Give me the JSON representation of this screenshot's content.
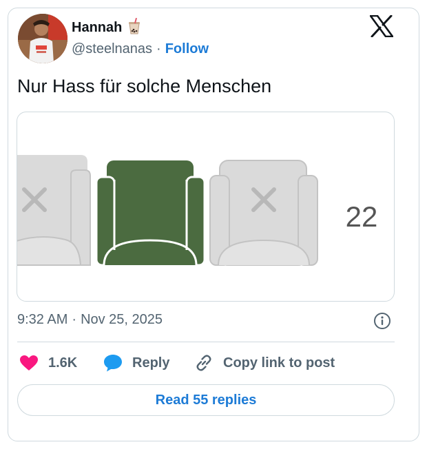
{
  "author": {
    "name": "Hannah",
    "name_emoji_icon": "bubble-tea-icon",
    "handle": "@steelnanas",
    "separator": "·",
    "follow_label": "Follow"
  },
  "brand_icon": "x-logo-icon",
  "tweet": {
    "text": "Nur Hass für solche Menschen"
  },
  "media": {
    "seat_count_label": "22",
    "seats": [
      {
        "state": "unavailable",
        "icon": "x-mark-icon"
      },
      {
        "state": "selected"
      },
      {
        "state": "unavailable",
        "icon": "x-mark-icon"
      }
    ],
    "colors": {
      "selected": "#4b6b40",
      "unavailable": "#d4d4d4",
      "outline": "#c5c5c5"
    }
  },
  "meta": {
    "time": "9:32 AM",
    "separator": "·",
    "date": "Nov 25, 2025"
  },
  "actions": {
    "like_count": "1.6K",
    "reply_label": "Reply",
    "copy_link_label": "Copy link to post"
  },
  "read_replies_label": "Read 55 replies",
  "colors": {
    "accent": "#1d7bd6",
    "like": "#f91880",
    "reply_icon": "#1d9bf0",
    "muted": "#536471"
  }
}
